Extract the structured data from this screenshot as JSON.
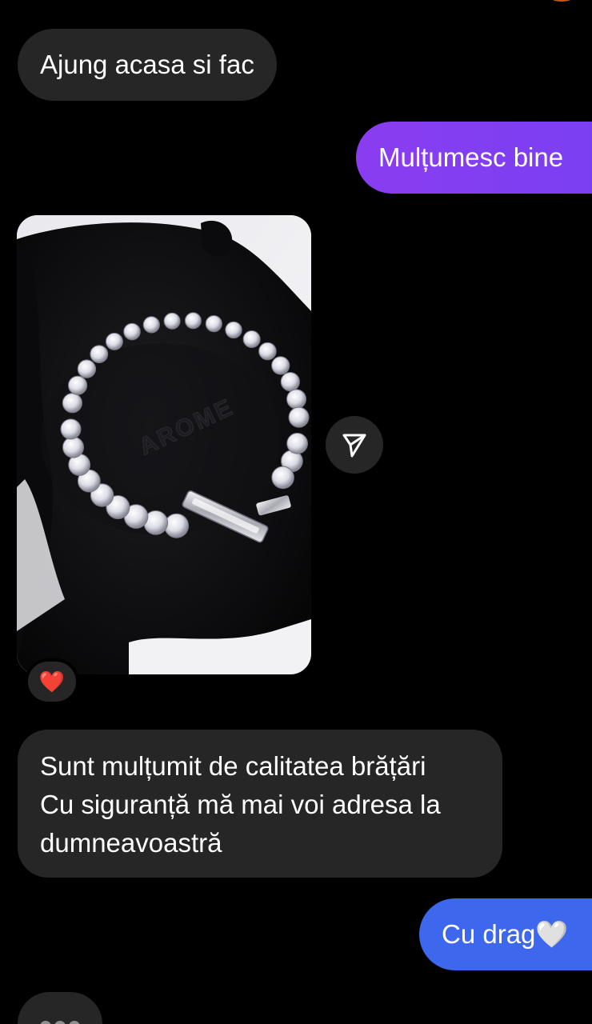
{
  "thread": {
    "messages": [
      {
        "direction": "incoming",
        "text": "Ajung acasa si fac"
      },
      {
        "direction": "outgoing",
        "text": "Mulțumesc bine"
      },
      {
        "direction": "incoming",
        "type": "photo",
        "photo_text": "AROME",
        "reaction": "❤️",
        "share_icon": "paper-plane-icon"
      },
      {
        "direction": "incoming",
        "lines": [
          "Sunt mulțumit de calitatea brățări",
          "Cu siguranță mă mai voi adresa la",
          "dumneavoastră"
        ]
      },
      {
        "direction": "outgoing",
        "text": "Cu drag🤍"
      }
    ],
    "typing_indicator": "typing-dots"
  },
  "colors": {
    "background": "#000000",
    "incoming_bubble": "#262626",
    "outgoing_purple": "#8a3df0",
    "outgoing_blue": "#3d67ec"
  }
}
